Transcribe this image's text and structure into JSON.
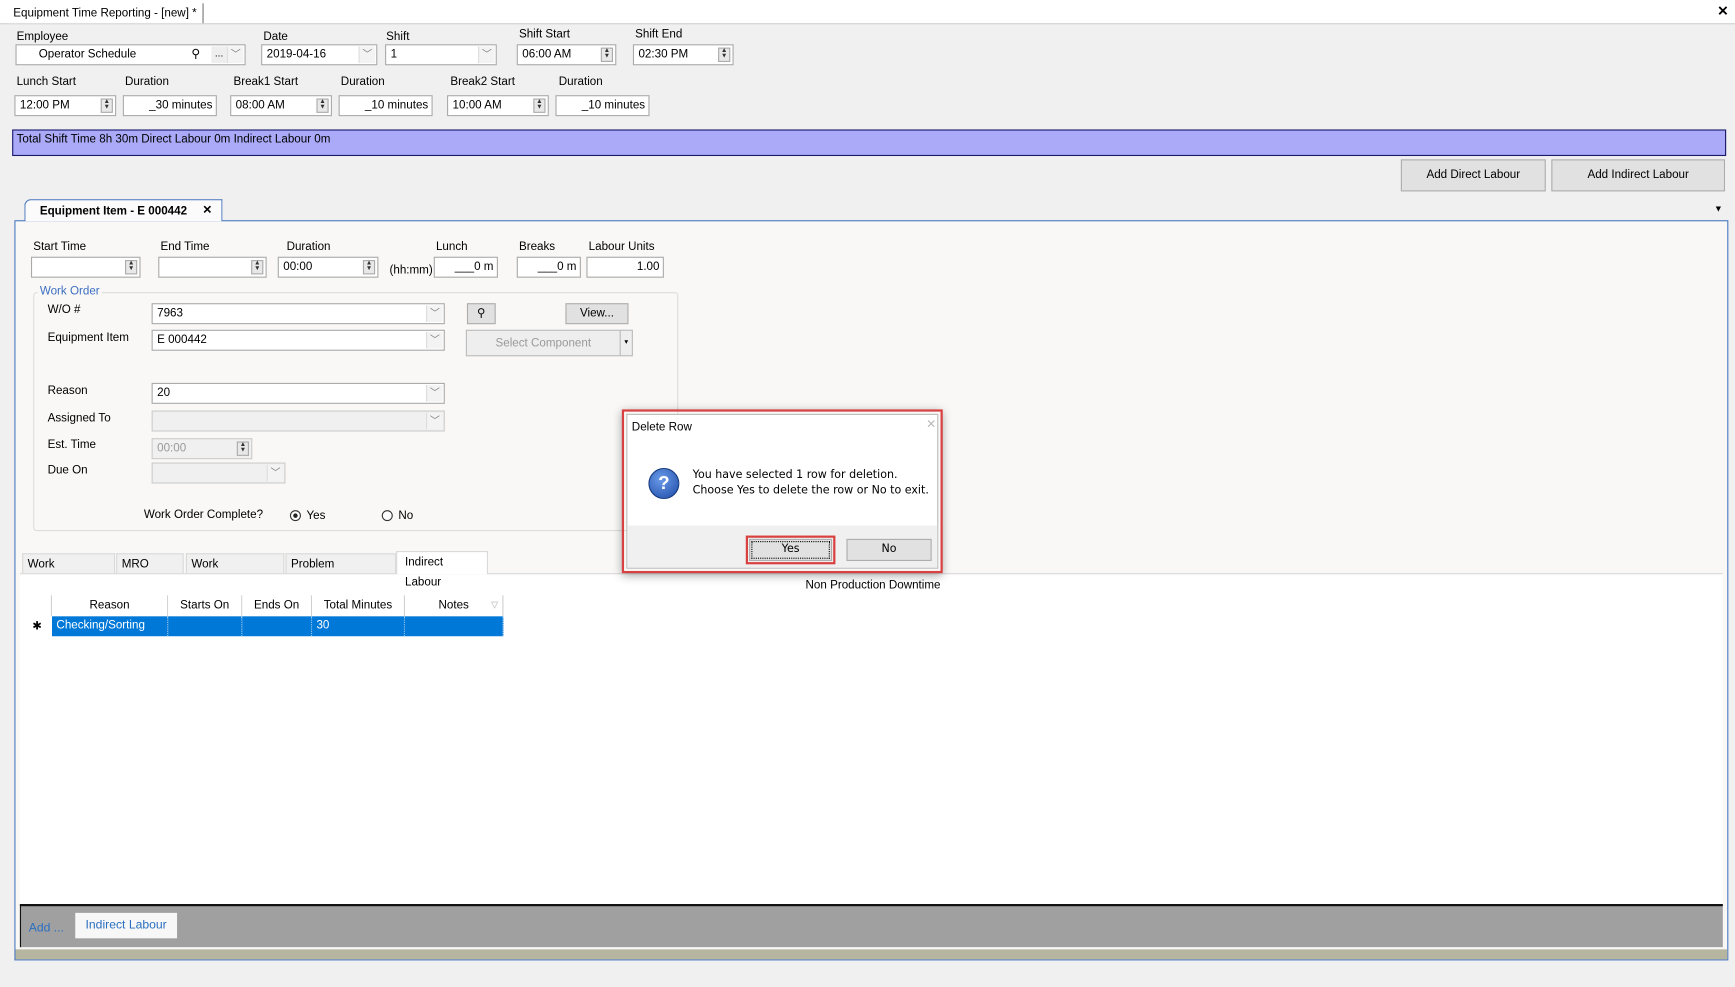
{
  "window": {
    "title": "Equipment Time Reporting - [new] *",
    "close_icon": "close-icon"
  },
  "header": {
    "employee": {
      "label": "Employee",
      "value": "Operator Schedule",
      "ellipsis": "..."
    },
    "date": {
      "label": "Date",
      "value": "2019-04-16"
    },
    "shift": {
      "label": "Shift",
      "value": "1"
    },
    "shift_start": {
      "label": "Shift Start",
      "value": "06:00 AM"
    },
    "shift_end": {
      "label": "Shift End",
      "value": "02:30 PM"
    },
    "lunch_start": {
      "label": "Lunch Start",
      "value": "12:00 PM"
    },
    "lunch_duration": {
      "label": "Duration",
      "value": "_30 minutes"
    },
    "break1_start": {
      "label": "Break1 Start",
      "value": "08:00 AM"
    },
    "break1_duration": {
      "label": "Duration",
      "value": "_10 minutes"
    },
    "break2_start": {
      "label": "Break2 Start",
      "value": "10:00 AM"
    },
    "break2_duration": {
      "label": "Duration",
      "value": "_10 minutes"
    }
  },
  "summary": {
    "text": "Total Shift Time 8h 30m  Direct Labour 0m  Indirect Labour 0m",
    "color": "#aaaaf8"
  },
  "actions": {
    "add_direct": "Add Direct Labour",
    "add_indirect": "Add Indirect Labour"
  },
  "doc_tab": {
    "label": "Equipment Item - E 000442",
    "close": "✕"
  },
  "times": {
    "start_time": {
      "label": "Start Time",
      "value": ""
    },
    "end_time": {
      "label": "End Time",
      "value": ""
    },
    "duration": {
      "label": "Duration",
      "value": "00:00",
      "unit": "(hh:mm)"
    },
    "lunch": {
      "label": "Lunch",
      "value": "___0 m"
    },
    "breaks": {
      "label": "Breaks",
      "value": "___0 m"
    },
    "labour_units": {
      "label": "Labour Units",
      "value": "1.00"
    }
  },
  "work_order": {
    "legend": "Work Order",
    "wo": {
      "label": "W/O #",
      "value": "7963"
    },
    "view_button": "View...",
    "equipment_item": {
      "label": "Equipment Item",
      "value": "E 000442"
    },
    "select_component": "Select Component",
    "reason": {
      "label": "Reason",
      "value": "20"
    },
    "assigned_to": {
      "label": "Assigned To",
      "value": ""
    },
    "est_time": {
      "label": "Est. Time",
      "value": "00:00"
    },
    "due_on": {
      "label": "Due On",
      "value": ""
    },
    "complete": {
      "label": "Work Order Complete?",
      "yes": "Yes",
      "no": "No",
      "selected": "Yes"
    }
  },
  "tabs": [
    {
      "label": "Work Performed",
      "active": false
    },
    {
      "label": "MRO Items",
      "active": false
    },
    {
      "label": "Work Instructions",
      "active": false
    },
    {
      "label": "Problem Description",
      "active": false
    },
    {
      "label": "Indirect Labour",
      "active": true
    }
  ],
  "indirect": {
    "caption": "Non Production Downtime",
    "columns": [
      "Reason",
      "Starts On",
      "Ends On",
      "Total Minutes",
      "Notes"
    ],
    "rows": [
      {
        "reason": "Checking/Sorting",
        "starts_on": "",
        "ends_on": "",
        "total_minutes": "30",
        "notes": ""
      }
    ],
    "row_indicator": "✱"
  },
  "footer": {
    "add_label": "Add ...",
    "add_button": "Indirect Labour"
  },
  "dialog": {
    "title": "Delete Row",
    "line1": "You have selected 1 row for deletion.",
    "line2": "Choose Yes to delete the row or No to exit.",
    "yes": "Yes",
    "no": "No",
    "icon": "question-icon",
    "highlight_color": "#d94040"
  }
}
